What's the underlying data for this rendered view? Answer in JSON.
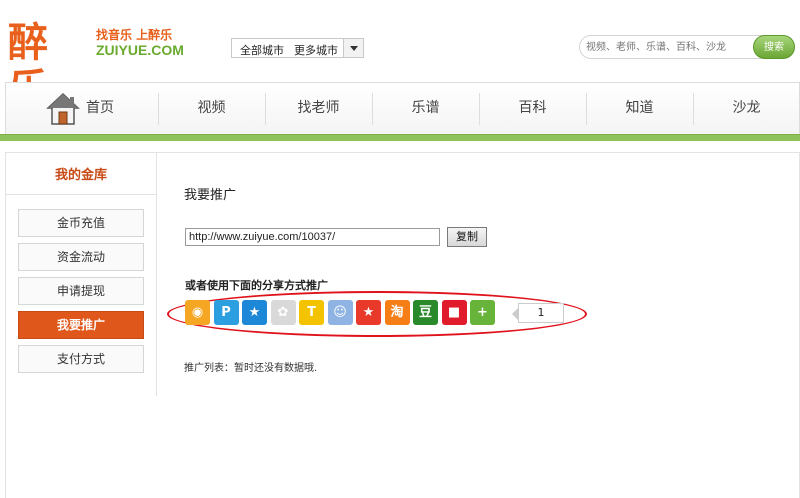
{
  "logo": {
    "cn": "醉乐",
    "slogan": "找音乐 上醉乐",
    "en": "ZUIYUE.COM"
  },
  "city": {
    "current": "全部城市",
    "more": "更多城市"
  },
  "search": {
    "placeholder": "视频、老师、乐谱、百科、沙龙",
    "button": "搜索"
  },
  "nav": {
    "items": [
      "首页",
      "视频",
      "找老师",
      "乐谱",
      "百科",
      "知道",
      "沙龙"
    ]
  },
  "sidebar": {
    "title": "我的金库",
    "items": [
      "金币充值",
      "资金流动",
      "申请提现",
      "我要推广",
      "支付方式"
    ],
    "active_index": 3
  },
  "main": {
    "title": "我要推广",
    "url": "http://www.zuiyue.com/10037/",
    "copy_label": "复制",
    "share_label": "或者使用下面的分享方式推广",
    "share_count": "1",
    "promo_list": "推广列表：暂时还没有数据哦."
  },
  "share_icons": [
    {
      "name": "weibo-share-icon",
      "glyph": "◉",
      "color": "#f5a623"
    },
    {
      "name": "qq-space-share-icon",
      "glyph": "P",
      "color": "#2b9fe0"
    },
    {
      "name": "qq-zone-star-share-icon",
      "glyph": "★",
      "color": "#1e88d8"
    },
    {
      "name": "renren-share-icon",
      "glyph": "✿",
      "color": "#d9d9d9"
    },
    {
      "name": "tianya-share-icon",
      "glyph": "T",
      "color": "#f3c300"
    },
    {
      "name": "kaixin-share-icon",
      "glyph": "☺",
      "color": "#8fb4e3"
    },
    {
      "name": "qq-weibo-share-icon",
      "glyph": "★",
      "color": "#e8392b"
    },
    {
      "name": "taobao-share-icon",
      "glyph": "淘",
      "color": "#f57e16"
    },
    {
      "name": "douban-share-icon",
      "glyph": "豆",
      "color": "#2a8a2a"
    },
    {
      "name": "baidu-share-icon",
      "glyph": "■",
      "color": "#e01b2b"
    },
    {
      "name": "more-share-icon",
      "glyph": "+",
      "color": "#68b33a"
    }
  ],
  "colors": {
    "brand_orange": "#e8601c",
    "brand_green": "#8fc25a",
    "active": "#e0571c",
    "highlight": "#e0121b"
  }
}
